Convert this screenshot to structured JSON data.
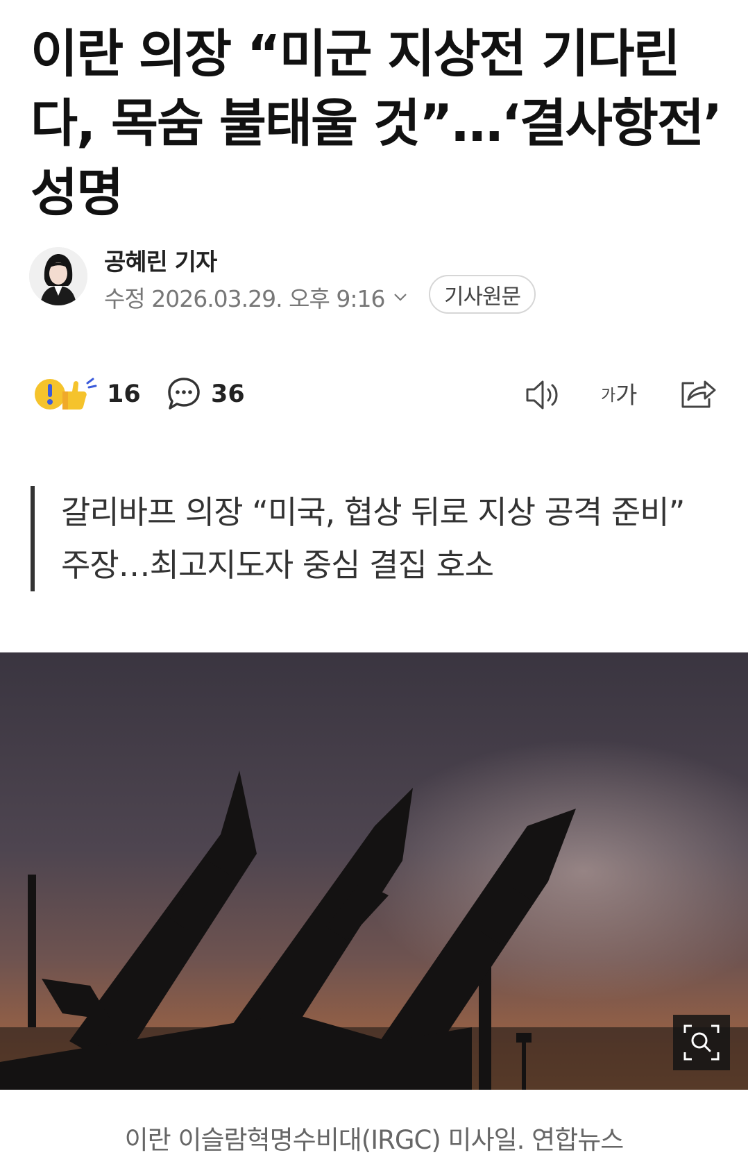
{
  "article": {
    "title": "이란 의장 “미군 지상전 기다린다, 목숨 불태울 것”…‘결사항전’ 성명",
    "reporter": "공혜린 기자",
    "modified": "수정 2026.03.29. 오후 9:16",
    "original_button": "기사원문",
    "reactions": {
      "count": "16"
    },
    "comments": {
      "count": "36"
    },
    "font_size_label_small": "가",
    "font_size_label_large": "가",
    "summary": "갈리바프 의장 “미국, 협상 뒤로 지상 공격 준비” 주장…최고지도자 중심 결집 호소",
    "photo_caption": "이란 이슬람혁명수비대(IRGC) 미사일. 연합뉴스"
  },
  "icons": {
    "reaction": "reaction-emoji-icon",
    "comment": "comment-bubble-icon",
    "audio": "speaker-icon",
    "share": "share-icon",
    "zoom": "zoom-icon",
    "chevron": "chevron-down-icon"
  },
  "colors": {
    "title": "#111111",
    "meta": "#777777",
    "accent_border": "#333333"
  }
}
